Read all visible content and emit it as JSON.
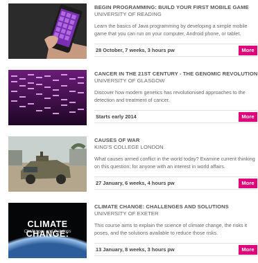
{
  "courses": [
    {
      "title": "BEGIN PROGRAMMING: BUILD YOUR FIRST MOBILE GAME",
      "university": "UNIVERSITY OF READING",
      "description": "Learn the basics of Java programming by developing a simple mobile game that you can run on your computer, Android phone, or tablet.",
      "date": "28 October, 7 weeks, 3 hours pw",
      "more_label": "More",
      "image_icon": "phone-game-image"
    },
    {
      "title": "CANCER IN THE 21ST CENTURY - THE GENOMIC REVOLUTION",
      "university": "UNIVERSITY OF GLASGOW",
      "description": "Discover how modern genetics has revolutionised approaches to the detection and treatment of cancer.",
      "date": "Starts early 2014",
      "more_label": "More",
      "image_icon": "dna-gel-image"
    },
    {
      "title": "CAUSES OF WAR",
      "university": "KING'S COLLEGE LONDON",
      "description": "What causes armed conflict in the world today? Examine current thinking on this question: for anyone with an interest in world affairs.",
      "date": "27 January, 6 weeks, 4 hours pw",
      "more_label": "More",
      "image_icon": "military-vehicle-image"
    },
    {
      "title": "CLIMATE CHANGE: CHALLENGES AND SOLUTIONS",
      "university": "UNIVERSITY OF EXETER",
      "description": "This course aims to explain the science of climate change, the risks it poses, and the solutions available to reduce those risks.",
      "date": "13 January, 8 weeks, 3 hours pw",
      "more_label": "More",
      "image_icon": "earth-horizon-image",
      "image_caption": "CLIMATE CHANGE:",
      "image_subcaption": "Challenges and Solutions"
    }
  ],
  "colors": {
    "accent": "#e2007a"
  }
}
